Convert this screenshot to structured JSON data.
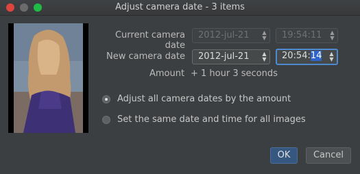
{
  "window": {
    "title": "Adjust camera date - 3 items"
  },
  "current": {
    "label": "Current camera date",
    "date": "2012-jul-21",
    "time": "19:54:11"
  },
  "new": {
    "label": "New camera date",
    "date": "2012-jul-21",
    "time_prefix": "20:54:",
    "time_selected": "14"
  },
  "amount": {
    "label": "Amount",
    "value": "+ 1 hour 3 seconds"
  },
  "options": {
    "adjust": "Adjust all camera dates by the amount",
    "same": "Set the same date and time for all images"
  },
  "buttons": {
    "ok": "OK",
    "cancel": "Cancel"
  },
  "spinner": {
    "up": "▲",
    "down": "▼"
  }
}
